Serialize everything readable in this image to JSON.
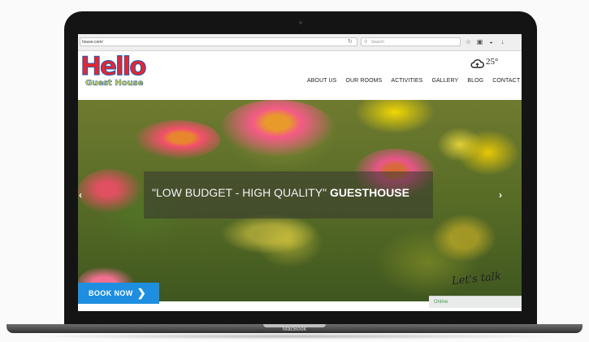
{
  "page": {
    "top_caption": ""
  },
  "browser": {
    "url": "house.com/",
    "search_placeholder": "Search"
  },
  "site": {
    "logo_word": "Hello",
    "logo_subtitle": "Guest House",
    "weather_temp": "25°",
    "nav": [
      "ABOUT US",
      "OUR ROOMS",
      "ACTIVITIES",
      "GALLERY",
      "BLOG",
      "CONTACT"
    ]
  },
  "hero": {
    "slide_text_quoted": "\"LOW BUDGET - HIGH QUALITY\"",
    "slide_text_bold": "GUESTHOUSE",
    "prev_arrow": "‹",
    "next_arrow": "›",
    "book_now_label": "BOOK NOW",
    "book_now_chevron": "❯",
    "chat_handwriting": "Let's talk",
    "chat_status": "Online"
  },
  "device": {
    "label": "MacBook"
  },
  "colors": {
    "book_button": "#1e8fe0",
    "logo_red": "#e8262c",
    "logo_yellow": "#f4e500",
    "chat_online_text": "#3aa14a"
  }
}
